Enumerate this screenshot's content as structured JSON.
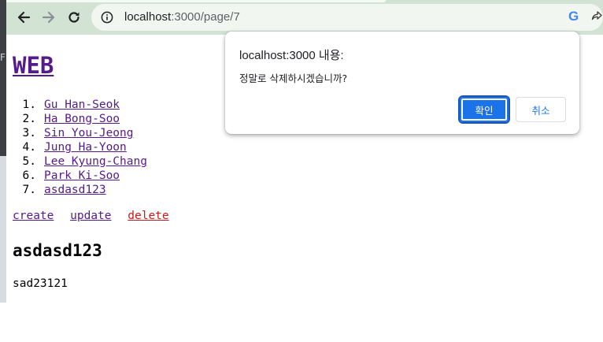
{
  "browser": {
    "url_host": "localhost",
    "url_rest": ":3000/page/7",
    "google_icon_glyph": "G",
    "icons": [
      "back-arrow-icon",
      "forward-arrow-icon",
      "reload-icon",
      "info-icon",
      "google-icon",
      "share-icon"
    ]
  },
  "page": {
    "title": "WEB",
    "list": [
      {
        "num": "1.",
        "label": "Gu Han-Seok"
      },
      {
        "num": "2.",
        "label": "Ha Bong-Soo"
      },
      {
        "num": "3.",
        "label": "Sin You-Jeong"
      },
      {
        "num": "4.",
        "label": "Jung Ha-Yoon"
      },
      {
        "num": "5.",
        "label": "Lee Kyung-Chang"
      },
      {
        "num": "6.",
        "label": "Park Ki-Soo"
      },
      {
        "num": "7.",
        "label": "asdasd123"
      }
    ],
    "actions": {
      "create": "create",
      "update": "update",
      "delete": "delete"
    },
    "article_title": "asdasd123",
    "article_body": "sad23121"
  },
  "dialog": {
    "origin": "localhost:3000 내용:",
    "message": "정말로 삭제하시겠습니까?",
    "ok_label": "확인",
    "cancel_label": "취소"
  },
  "edge": {
    "letter": "F"
  },
  "colors": {
    "toolbar": "#d3e3d3",
    "visited_link": "#551a8b",
    "delete_link": "#cc1a1a",
    "primary_button": "#1a73e8"
  }
}
